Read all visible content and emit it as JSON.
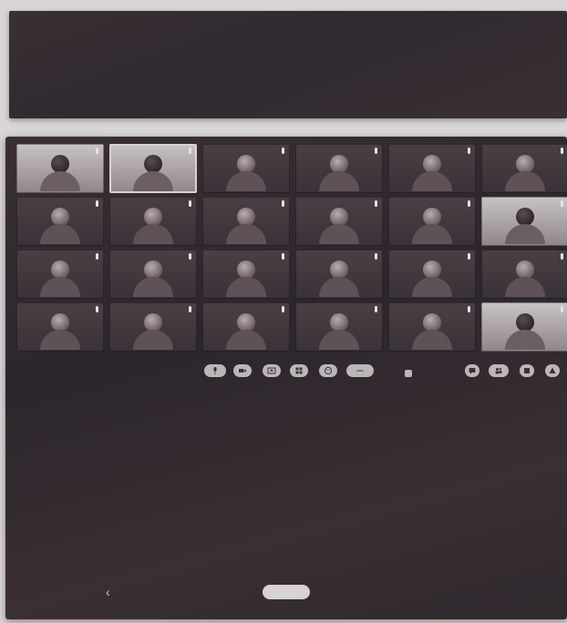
{
  "meeting": {
    "info_text": "",
    "participants": [
      {
        "name": "",
        "bright": true,
        "active": false
      },
      {
        "name": "",
        "bright": true,
        "active": true
      },
      {
        "name": "",
        "bright": false,
        "active": false
      },
      {
        "name": "",
        "bright": false,
        "active": false
      },
      {
        "name": "",
        "bright": false,
        "active": false
      },
      {
        "name": "",
        "bright": false,
        "active": false
      },
      {
        "name": "",
        "bright": false,
        "active": false
      },
      {
        "name": "",
        "bright": false,
        "active": false
      },
      {
        "name": "",
        "bright": false,
        "active": false
      },
      {
        "name": "",
        "bright": false,
        "active": false
      },
      {
        "name": "",
        "bright": false,
        "active": false
      },
      {
        "name": "",
        "bright": true,
        "active": false
      },
      {
        "name": "",
        "bright": false,
        "active": false
      },
      {
        "name": "",
        "bright": false,
        "active": false
      },
      {
        "name": "",
        "bright": false,
        "active": false
      },
      {
        "name": "",
        "bright": false,
        "active": false
      },
      {
        "name": "",
        "bright": false,
        "active": false
      },
      {
        "name": "",
        "bright": false,
        "active": false
      },
      {
        "name": "",
        "bright": false,
        "active": false
      },
      {
        "name": "",
        "bright": false,
        "active": false
      },
      {
        "name": "",
        "bright": false,
        "active": false
      },
      {
        "name": "",
        "bright": false,
        "active": false
      },
      {
        "name": "",
        "bright": false,
        "active": false
      },
      {
        "name": "",
        "bright": true,
        "active": false
      }
    ],
    "controls_left": [
      "mic-icon",
      "video-icon",
      "share-icon",
      "grid-icon",
      "reactions-icon",
      "more-icon"
    ],
    "controls_right": [
      "chat-icon",
      "people-icon",
      "record-icon",
      "settings-icon"
    ]
  },
  "colors": {
    "window_bg": "#2f292e",
    "tile_bg": "#3a3238",
    "bright_tile_bg": "#c9c3c5",
    "accent_light": "#d8d2d4"
  }
}
